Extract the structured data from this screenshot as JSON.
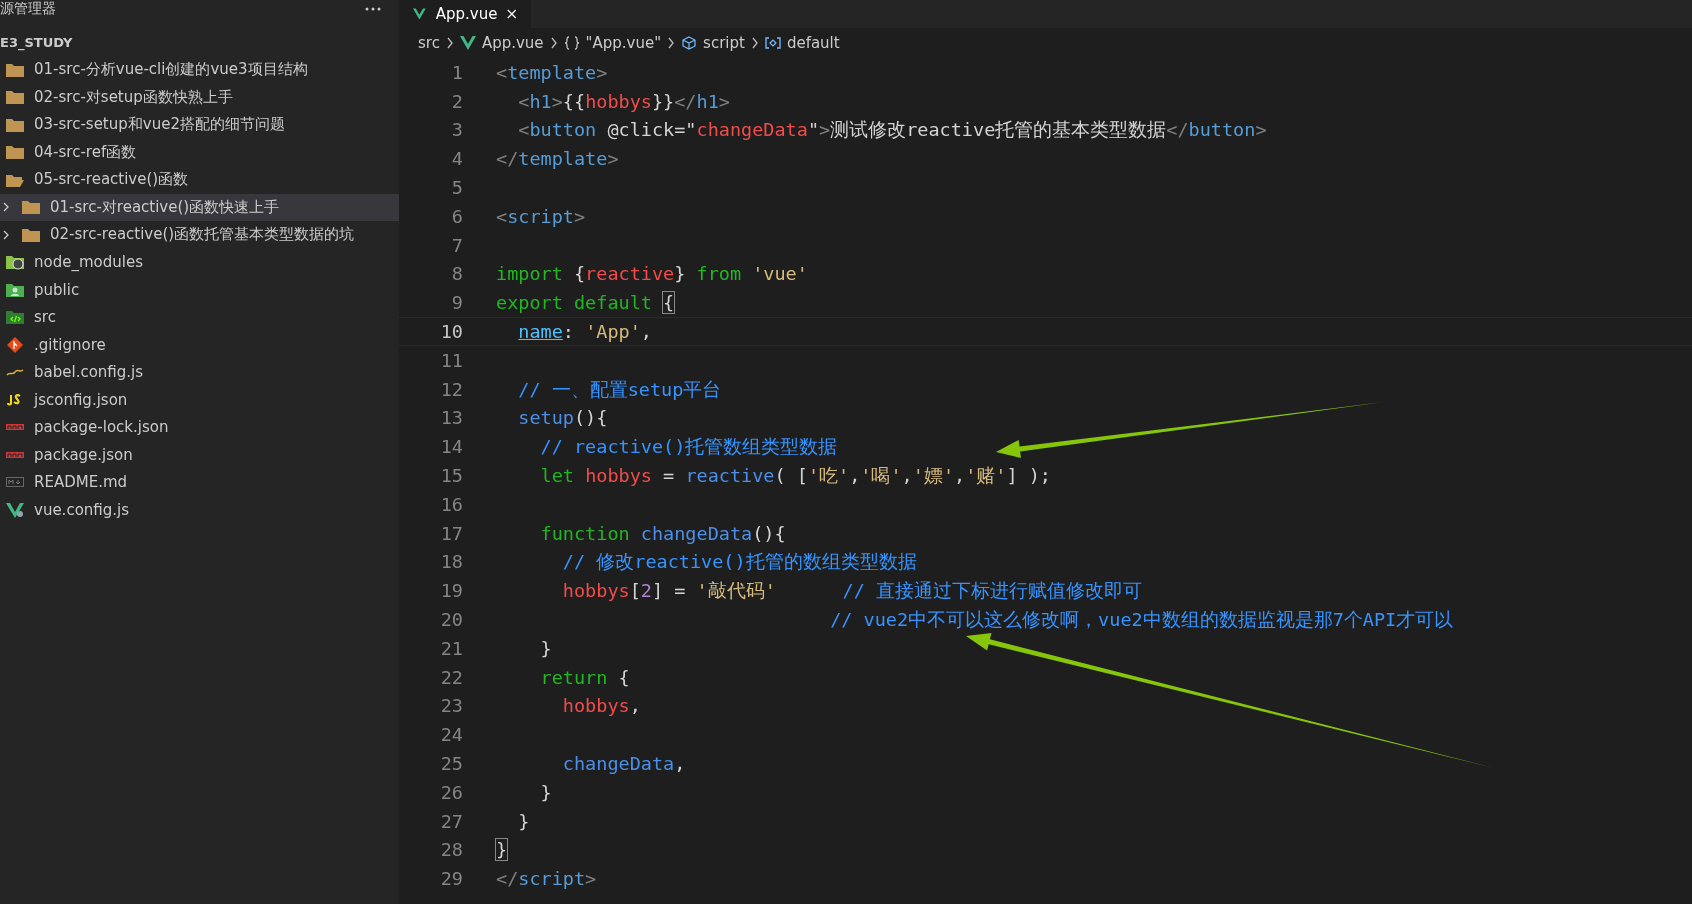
{
  "sidebar": {
    "header": "源管理器",
    "project": "E3_STUDY",
    "items": [
      {
        "label": "01-src-分析vue-cli创建的vue3项目结构",
        "kind": "folder",
        "expanded": false,
        "selected": false
      },
      {
        "label": "02-src-对setup函数快熟上手",
        "kind": "folder",
        "expanded": false,
        "selected": false
      },
      {
        "label": "03-src-setup和vue2搭配的细节问题",
        "kind": "folder",
        "expanded": false,
        "selected": false
      },
      {
        "label": "04-src-ref函数",
        "kind": "folder",
        "expanded": false,
        "selected": false
      },
      {
        "label": "05-src-reactive()函数",
        "kind": "folder",
        "expanded": true,
        "selected": false,
        "children": [
          {
            "label": "01-src-对reactive()函数快速上手",
            "kind": "folder",
            "expanded": false,
            "selected": true
          },
          {
            "label": "02-src-reactive()函数托管基本类型数据的坑",
            "kind": "folder",
            "expanded": false,
            "selected": false
          }
        ]
      },
      {
        "label": "node_modules",
        "kind": "node-folder",
        "selected": false
      },
      {
        "label": "public",
        "kind": "public-folder",
        "selected": false
      },
      {
        "label": "src",
        "kind": "src-folder",
        "selected": false
      },
      {
        "label": ".gitignore",
        "kind": "git",
        "selected": false
      },
      {
        "label": "babel.config.js",
        "kind": "babel",
        "selected": false
      },
      {
        "label": "jsconfig.json",
        "kind": "js",
        "selected": false
      },
      {
        "label": "package-lock.json",
        "kind": "npm",
        "selected": false
      },
      {
        "label": "package.json",
        "kind": "npm",
        "selected": false
      },
      {
        "label": "README.md",
        "kind": "markdown",
        "selected": false
      },
      {
        "label": "vue.config.js",
        "kind": "vue",
        "selected": false
      }
    ]
  },
  "tabs": [
    {
      "label": "App.vue",
      "selected": true
    }
  ],
  "breadcrumb": [
    {
      "label": "src",
      "kind": "plain"
    },
    {
      "label": "App.vue",
      "kind": "vue"
    },
    {
      "label": "\"App.vue\"",
      "kind": "braces"
    },
    {
      "label": "script",
      "kind": "cube"
    },
    {
      "label": "default",
      "kind": "variable"
    }
  ],
  "editor": {
    "lines": [
      {
        "number": "1",
        "current": false,
        "tokens": [
          {
            "t": "<",
            "kind": "punct"
          },
          {
            "t": "template",
            "kind": "tag"
          },
          {
            "t": ">",
            "kind": "punct"
          }
        ]
      },
      {
        "number": "2",
        "current": false,
        "tokens": [
          {
            "t": "  <",
            "kind": "punct"
          },
          {
            "t": "h1",
            "kind": "tag"
          },
          {
            "t": ">",
            "kind": "punct"
          },
          {
            "t": "{{",
            "kind": "text"
          },
          {
            "t": "hobbys",
            "kind": "var"
          },
          {
            "t": "}}",
            "kind": "text"
          },
          {
            "t": "</",
            "kind": "punct"
          },
          {
            "t": "h1",
            "kind": "tag"
          },
          {
            "t": ">",
            "kind": "punct"
          }
        ]
      },
      {
        "number": "3",
        "current": false,
        "tokens": [
          {
            "t": "  <",
            "kind": "punct"
          },
          {
            "t": "button",
            "kind": "tag"
          },
          {
            "t": " @click=\"",
            "kind": "text"
          },
          {
            "t": "changeData",
            "kind": "var"
          },
          {
            "t": "\"",
            "kind": "text"
          },
          {
            "t": ">",
            "kind": "punct"
          },
          {
            "t": "测试修改reactive托管的基本类型数据",
            "kind": "text"
          },
          {
            "t": "</",
            "kind": "punct"
          },
          {
            "t": "button",
            "kind": "tag"
          },
          {
            "t": ">",
            "kind": "punct"
          }
        ]
      },
      {
        "number": "4",
        "current": false,
        "tokens": [
          {
            "t": "</",
            "kind": "punct"
          },
          {
            "t": "template",
            "kind": "tag"
          },
          {
            "t": ">",
            "kind": "punct"
          }
        ]
      },
      {
        "number": "5",
        "current": false
      },
      {
        "number": "6",
        "current": false,
        "tokens": [
          {
            "t": "<",
            "kind": "punct"
          },
          {
            "t": "script",
            "kind": "tag"
          },
          {
            "t": ">",
            "kind": "punct"
          }
        ]
      },
      {
        "number": "7",
        "current": false
      },
      {
        "number": "8",
        "current": false,
        "tokens": [
          {
            "t": "import",
            "kind": "kw"
          },
          {
            "t": " {",
            "kind": "text"
          },
          {
            "t": "reactive",
            "kind": "var"
          },
          {
            "t": "} ",
            "kind": "text"
          },
          {
            "t": "from",
            "kind": "kw"
          },
          {
            "t": " 'vue'",
            "kind": "str"
          }
        ]
      },
      {
        "number": "9",
        "current": false,
        "tokens": [
          {
            "t": "export",
            "kind": "kw"
          },
          {
            "t": " default ",
            "kind": "kw"
          },
          {
            "t": "{",
            "kind": "match"
          }
        ]
      },
      {
        "number": "10",
        "current": true,
        "tokens": [
          {
            "t": "  name",
            "kind": "prop"
          },
          {
            "t": ": ",
            "kind": "text"
          },
          {
            "t": "'App'",
            "kind": "str"
          },
          {
            "t": ",",
            "kind": "text"
          }
        ]
      },
      {
        "number": "11",
        "current": false
      },
      {
        "number": "12",
        "current": false,
        "tokens": [
          {
            "t": "  // 一、配置setup平台",
            "kind": "comment"
          }
        ]
      },
      {
        "number": "13",
        "current": false,
        "tokens": [
          {
            "t": "  setup",
            "kind": "fn"
          },
          {
            "t": "(){",
            "kind": "text"
          }
        ]
      },
      {
        "number": "14",
        "current": false,
        "tokens": [
          {
            "t": "    // reactive()托管数组类型数据",
            "kind": "comment"
          }
        ]
      },
      {
        "number": "15",
        "current": false,
        "tokens": [
          {
            "t": "    let",
            "kind": "kw"
          },
          {
            "t": " hobbys",
            "kind": "var"
          },
          {
            "t": " = ",
            "kind": "text"
          },
          {
            "t": "reactive",
            "kind": "fn"
          },
          {
            "t": "( [",
            "kind": "text"
          },
          {
            "t": "'吃'",
            "kind": "str"
          },
          {
            "t": ",",
            "kind": "text"
          },
          {
            "t": "'喝'",
            "kind": "str"
          },
          {
            "t": ",",
            "kind": "text"
          },
          {
            "t": "'嫖'",
            "kind": "str"
          },
          {
            "t": ",",
            "kind": "text"
          },
          {
            "t": "'赌'",
            "kind": "str"
          },
          {
            "t": "] );",
            "kind": "text"
          }
        ]
      },
      {
        "number": "16",
        "current": false
      },
      {
        "number": "17",
        "current": false,
        "tokens": [
          {
            "t": "    function",
            "kind": "kw"
          },
          {
            "t": " changeData",
            "kind": "fn"
          },
          {
            "t": "(){",
            "kind": "text"
          }
        ]
      },
      {
        "number": "18",
        "current": false,
        "tokens": [
          {
            "t": "      // 修改reactive()托管的数组类型数据",
            "kind": "comment"
          }
        ]
      },
      {
        "number": "19",
        "current": false,
        "tokens": [
          {
            "t": "      hobbys",
            "kind": "var"
          },
          {
            "t": "[",
            "kind": "text"
          },
          {
            "t": "2",
            "kind": "num"
          },
          {
            "t": "] = ",
            "kind": "text"
          },
          {
            "t": "'敲代码'",
            "kind": "str"
          },
          {
            "t": "      // 直接通过下标进行赋值修改即可",
            "kind": "comment"
          }
        ]
      },
      {
        "number": "20",
        "current": false,
        "tokens": [
          {
            "t": "                              // vue2中不可以这么修改啊，vue2中数组的数据监视是那7个API才可以",
            "kind": "comment"
          }
        ]
      },
      {
        "number": "21",
        "current": false,
        "tokens": [
          {
            "t": "    }",
            "kind": "text"
          }
        ]
      },
      {
        "number": "22",
        "current": false,
        "tokens": [
          {
            "t": "    return",
            "kind": "kw"
          },
          {
            "t": " {",
            "kind": "text"
          }
        ]
      },
      {
        "number": "23",
        "current": false,
        "tokens": [
          {
            "t": "      hobbys",
            "kind": "var"
          },
          {
            "t": ",",
            "kind": "text"
          }
        ]
      },
      {
        "number": "24",
        "current": false
      },
      {
        "number": "25",
        "current": false,
        "tokens": [
          {
            "t": "      changeData",
            "kind": "fn"
          },
          {
            "t": ",",
            "kind": "text"
          }
        ]
      },
      {
        "number": "26",
        "current": false,
        "tokens": [
          {
            "t": "    }",
            "kind": "text"
          }
        ]
      },
      {
        "number": "27",
        "current": false,
        "tokens": [
          {
            "t": "  }",
            "kind": "text"
          }
        ]
      },
      {
        "number": "28",
        "current": false,
        "tokens": [
          {
            "t": "}",
            "kind": "match"
          }
        ]
      },
      {
        "number": "29",
        "current": false,
        "tokens": [
          {
            "t": "</",
            "kind": "punct"
          },
          {
            "t": "script",
            "kind": "tag"
          },
          {
            "t": ">",
            "kind": "punct"
          }
        ]
      }
    ]
  }
}
